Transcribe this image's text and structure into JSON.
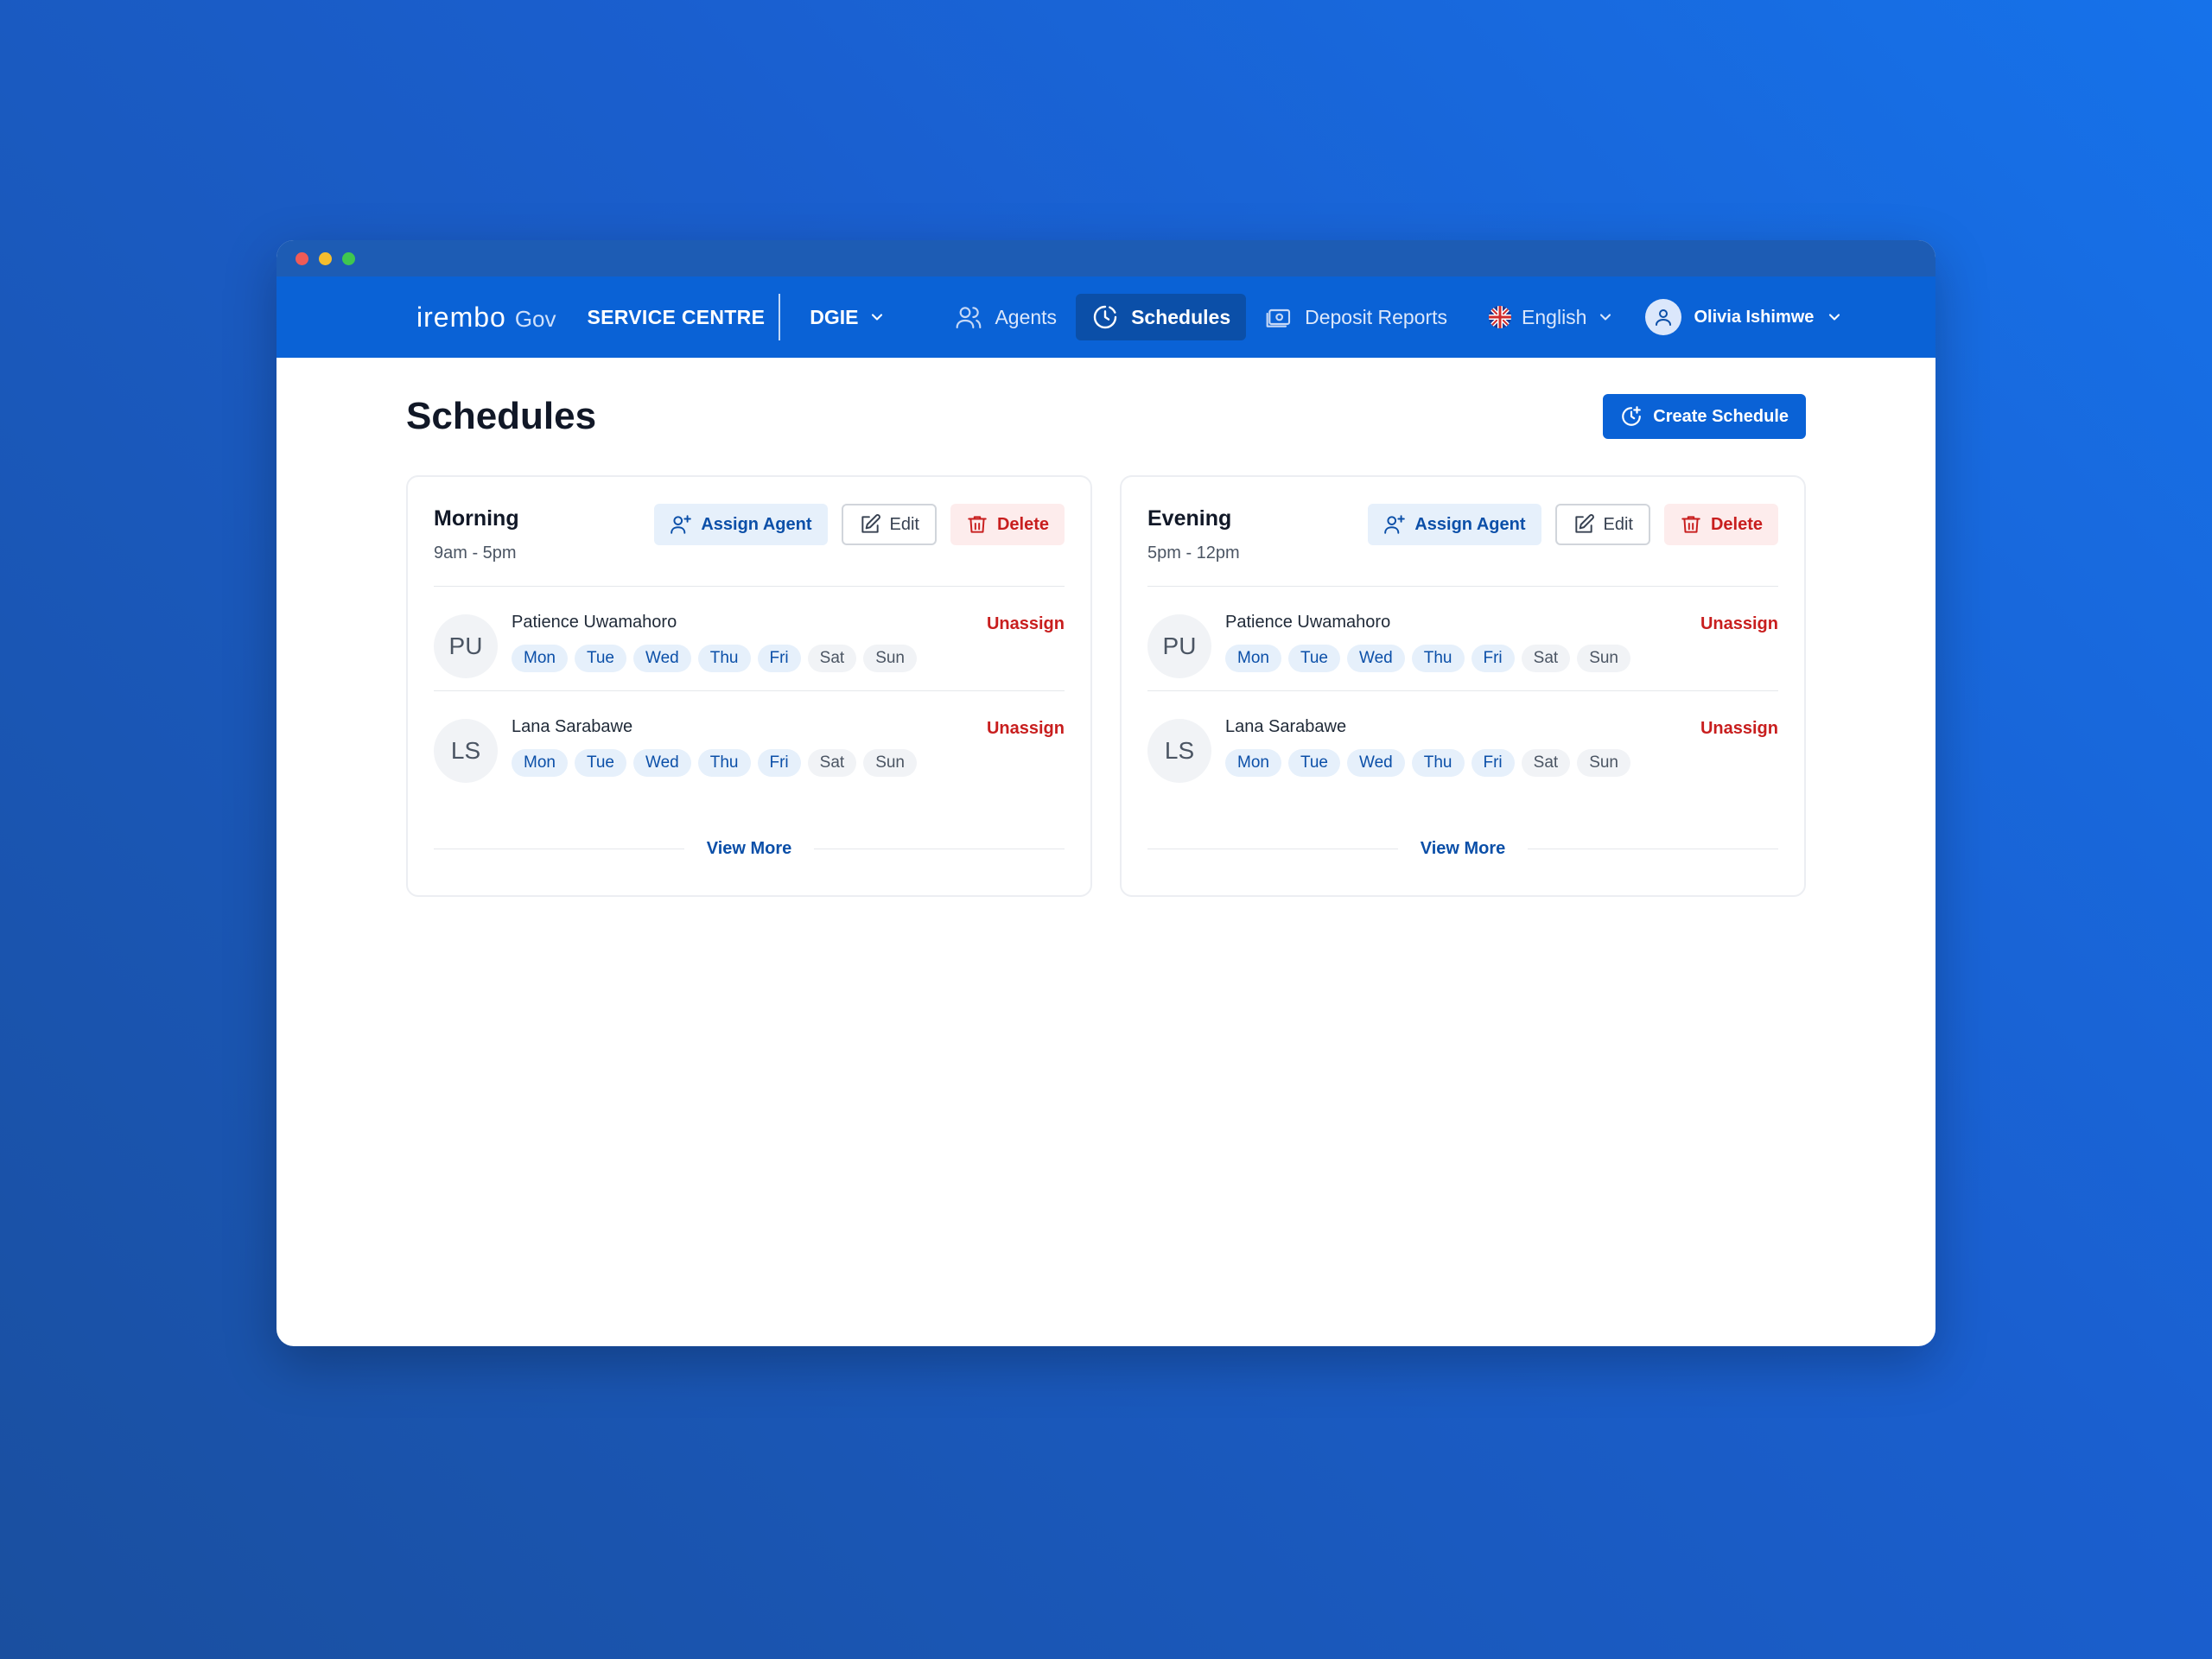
{
  "brand": {
    "logo_main": "irembo",
    "logo_sub": "Gov"
  },
  "nav": {
    "service_centre": "SERVICE CENTRE",
    "org": "DGIE",
    "items": [
      {
        "label": "Agents",
        "icon": "users-icon",
        "active": false
      },
      {
        "label": "Schedules",
        "icon": "clock-icon",
        "active": true
      },
      {
        "label": "Deposit Reports",
        "icon": "money-icon",
        "active": false
      }
    ],
    "language": "English",
    "user": "Olivia Ishimwe"
  },
  "page": {
    "title": "Schedules",
    "create_label": "Create Schedule"
  },
  "actions": {
    "assign": "Assign Agent",
    "edit": "Edit",
    "delete": "Delete",
    "unassign": "Unassign",
    "view_more": "View More"
  },
  "schedules": [
    {
      "name": "Morning",
      "time": "9am - 5pm",
      "agents": [
        {
          "initials": "PU",
          "name": "Patience Uwamahoro",
          "days": [
            "Mon",
            "Tue",
            "Wed",
            "Thu",
            "Fri",
            "Sat",
            "Sun"
          ]
        },
        {
          "initials": "LS",
          "name": "Lana Sarabawe",
          "days": [
            "Mon",
            "Tue",
            "Wed",
            "Thu",
            "Fri",
            "Sat",
            "Sun"
          ]
        }
      ]
    },
    {
      "name": "Evening",
      "time": "5pm - 12pm",
      "agents": [
        {
          "initials": "PU",
          "name": "Patience Uwamahoro",
          "days": [
            "Mon",
            "Tue",
            "Wed",
            "Thu",
            "Fri",
            "Sat",
            "Sun"
          ]
        },
        {
          "initials": "LS",
          "name": "Lana Sarabawe",
          "days": [
            "Mon",
            "Tue",
            "Wed",
            "Thu",
            "Fri",
            "Sat",
            "Sun"
          ]
        }
      ]
    }
  ],
  "colors": {
    "primary": "#0a62d6",
    "nav_active": "#0b4fa8",
    "danger": "#c81e1e",
    "chip_on": "#e6f0fb",
    "chip_off": "#f1f3f6"
  }
}
